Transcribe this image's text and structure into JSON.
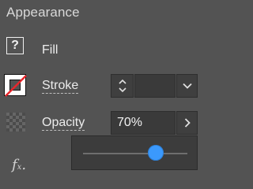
{
  "panel": {
    "title": "Appearance"
  },
  "fill": {
    "label": "Fill",
    "swatch_symbol": "?"
  },
  "stroke": {
    "label": "Stroke",
    "weight_value": "",
    "swatch_icon": "none-swatch-icon"
  },
  "opacity": {
    "label": "Opacity",
    "value": "70%",
    "slider_fraction": 0.7
  },
  "fx": {
    "symbol": "fx"
  },
  "colors": {
    "panel_bg": "#535353",
    "accent": "#3b99fc",
    "none_slash": "#e8262b"
  }
}
